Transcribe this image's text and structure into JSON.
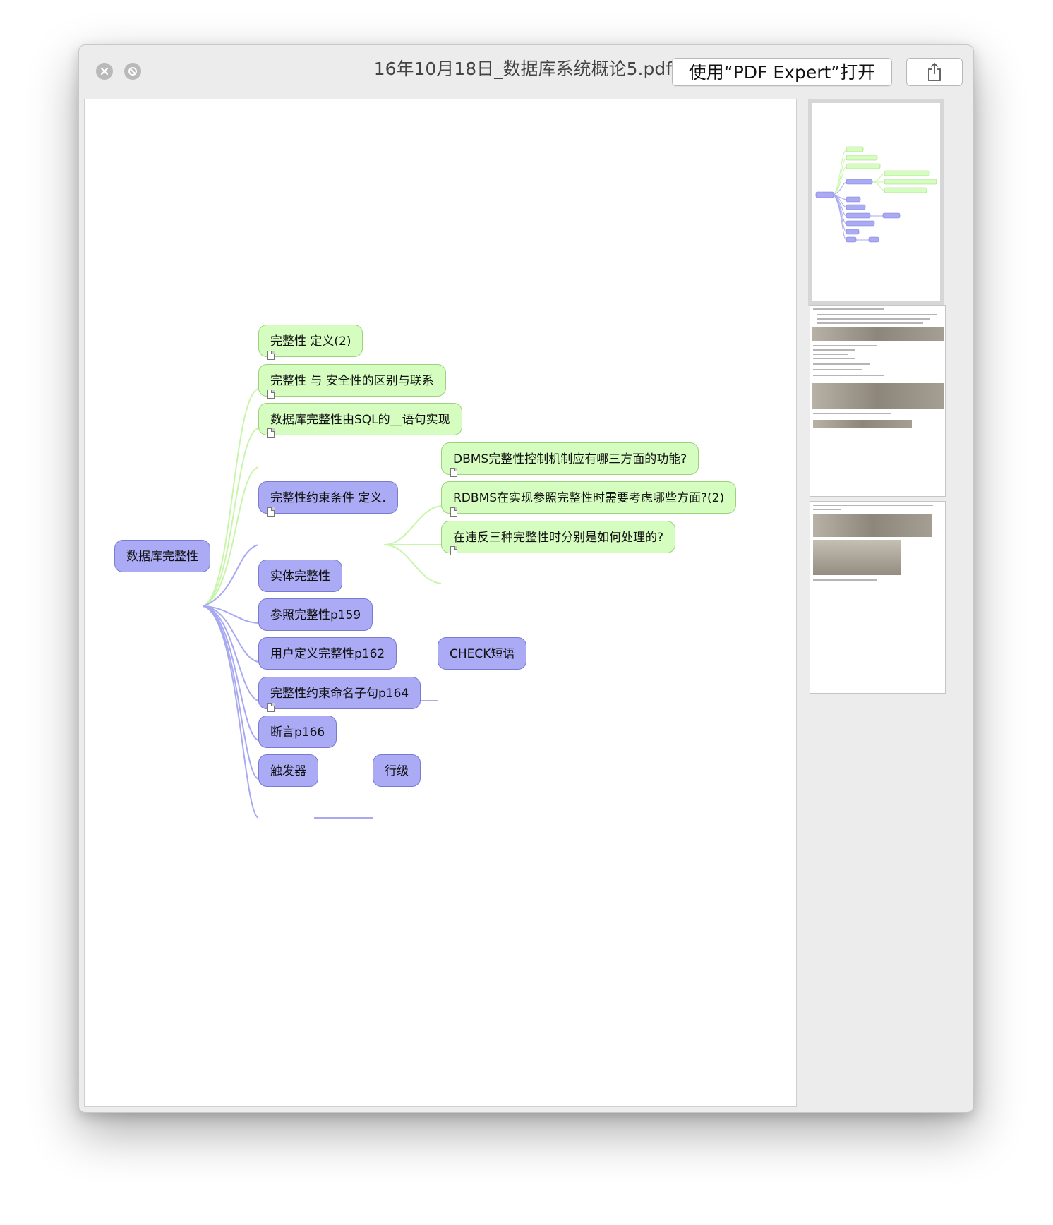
{
  "window": {
    "title": "16年10月18日_数据库系统概论5.pdf",
    "open_button_label": "使用“PDF Expert”打开"
  },
  "mindmap": {
    "root": "数据库完整性",
    "branches": [
      "完整性 定义(2)",
      "完整性 与 安全性的区别与联系",
      "数据库完整性由SQL的__语句实现",
      "完整性约束条件 定义.",
      "实体完整性",
      "参照完整性p159",
      "用户定义完整性p162",
      "完整性约束命名子句p164",
      "断言p166",
      "触发器"
    ],
    "sub_constraint": [
      "DBMS完整性控制机制应有哪三方面的功能?",
      "RDBMS在实现参照完整性时需要考虑哪些方面?(2)",
      "在违反三种完整性时分别是如何处理的?"
    ],
    "sub_user_defined": "CHECK短语",
    "sub_trigger": "行级"
  },
  "colors": {
    "green_node": "#d6fdc0",
    "blue_node": "#aaaaf5",
    "green_line": "#c9f5ab",
    "blue_line": "#a9a9f2"
  },
  "icons": [
    "close-icon",
    "fullscreen-icon",
    "share-icon",
    "note-icon"
  ]
}
